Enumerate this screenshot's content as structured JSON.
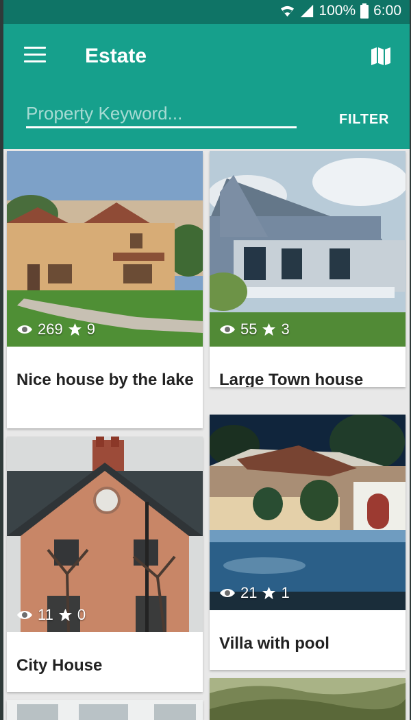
{
  "status": {
    "battery_percent": "100%",
    "time": "6:00"
  },
  "appbar": {
    "title": "Estate",
    "search_placeholder": "Property Keyword...",
    "filter_label": "FILTER"
  },
  "icons": {
    "menu": "hamburger-menu-icon",
    "map": "map-icon",
    "views": "eye-icon",
    "rating": "star-icon"
  },
  "colors": {
    "status_bar": "#0f7466",
    "app_bar": "#16a08c",
    "background": "#e8e8e8"
  },
  "properties": [
    {
      "title": "Nice house by the lake",
      "views": "269",
      "stars": "9"
    },
    {
      "title": "Large Town house",
      "views": "55",
      "stars": "3"
    },
    {
      "title": "City House",
      "views": "11",
      "stars": "0"
    },
    {
      "title": "Villa with pool",
      "views": "21",
      "stars": "1"
    }
  ]
}
